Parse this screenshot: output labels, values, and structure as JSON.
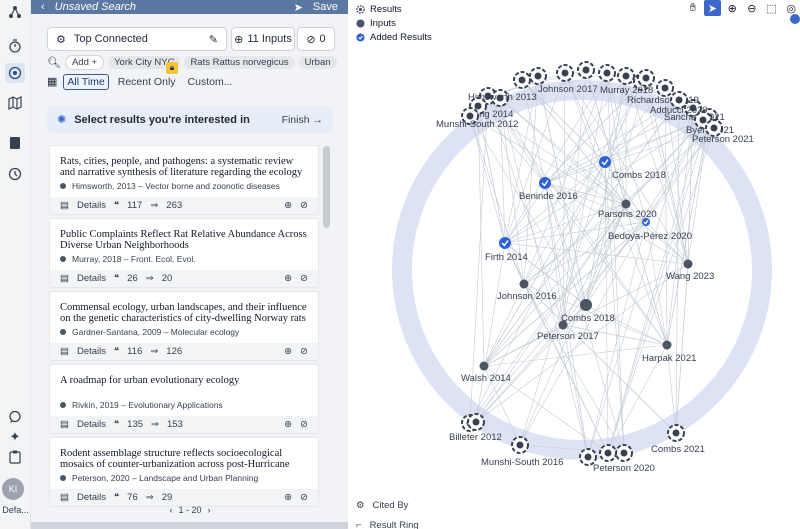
{
  "search": {
    "title": "Unsaved Search",
    "save_label": "Save",
    "strategy_label": "Top Connected",
    "inputs_label": "11 Inputs",
    "zero_label": "0",
    "add_label": "Add",
    "add_plus": "+",
    "chips": [
      "York City NYC",
      "Rats Rattus norvegicus",
      "Urban"
    ],
    "time_filters": [
      "All Time",
      "Recent Only",
      "Custom..."
    ],
    "banner_text": "Select results you're interested in",
    "finish_label": "Finish"
  },
  "results": [
    {
      "title": "Rats, cities, people, and pathogens: a systematic review and narrative synthesis of literature regarding the ecology of",
      "meta": "Himsworth, 2013 – Vector borne and zoonotic diseases",
      "details": "Details",
      "quotes": "117",
      "cites": "263"
    },
    {
      "title": "Public Complaints Reflect Rat Relative Abundance Across Diverse Urban Neighborhoods",
      "meta": "Murray, 2018 – Front. Ecol. Evol.",
      "details": "Details",
      "quotes": "26",
      "cites": "20"
    },
    {
      "title": "Commensal ecology, urban landscapes, and their influence on the genetic characteristics of city-dwelling Norway rats",
      "meta": "Gardner-Santana, 2009 – Molecular ecology",
      "details": "Details",
      "quotes": "116",
      "cites": "126"
    },
    {
      "title": "A roadmap for urban evolutionary ecology",
      "meta": "Rivkin, 2019 – Evolutionary Applications",
      "details": "Details",
      "quotes": "135",
      "cites": "153"
    },
    {
      "title": "Rodent assemblage structure reflects socioecological mosaics of counter-urbanization across post-Hurricane",
      "meta": "Peterson, 2020 – Landscape and Urban Planning",
      "details": "Details",
      "quotes": "76",
      "cites": "29"
    }
  ],
  "pager": {
    "text": "1 - 20"
  },
  "rail": {
    "avatar": "KI",
    "footer": "Defa..."
  },
  "legend": {
    "results": "Results",
    "inputs": "Inputs",
    "added": "Added Results"
  },
  "bottom_legend": {
    "cited_by": "Cited By",
    "result_ring": "Result Ring"
  },
  "colors": {
    "accent": "#3b67c9",
    "ring": "#dde3f5",
    "input_node": "#4b5563",
    "added_node": "#2f62d6",
    "topbar": "#5b78a3"
  },
  "graph": {
    "nodes": [
      {
        "label": "Himsworth 2013",
        "kind": "result"
      },
      {
        "label": "Johnson 2017",
        "kind": "result"
      },
      {
        "label": "Murray 2018",
        "kind": "result"
      },
      {
        "label": "Richardson 2019",
        "kind": "result"
      },
      {
        "label": "Adducci 2020",
        "kind": "result"
      },
      {
        "label": "Sanchez 2021",
        "kind": "result"
      },
      {
        "label": "Feng 2014",
        "kind": "result"
      },
      {
        "label": "Munshi-South 2012",
        "kind": "result"
      },
      {
        "label": "Byers 2021",
        "kind": "result"
      },
      {
        "label": "Peterson 2021",
        "kind": "result"
      },
      {
        "label": "Combs 2018",
        "kind": "added"
      },
      {
        "label": "Beninde 2016",
        "kind": "added"
      },
      {
        "label": "Parsons 2020",
        "kind": "input"
      },
      {
        "label": "Bedoya-Pérez 2020",
        "kind": "added"
      },
      {
        "label": "Firth 2014",
        "kind": "added"
      },
      {
        "label": "Wang 2023",
        "kind": "input"
      },
      {
        "label": "Johnson 2016",
        "kind": "input"
      },
      {
        "label": "Combs 2018",
        "kind": "input"
      },
      {
        "label": "Peterson 2017",
        "kind": "input"
      },
      {
        "label": "Harpak 2021",
        "kind": "input"
      },
      {
        "label": "Walsh 2014",
        "kind": "input"
      },
      {
        "label": "Billeter 2012",
        "kind": "result"
      },
      {
        "label": "Munshi-South 2016",
        "kind": "result"
      },
      {
        "label": "Peterson 2020",
        "kind": "result"
      },
      {
        "label": "Combs 2021",
        "kind": "result"
      }
    ]
  }
}
